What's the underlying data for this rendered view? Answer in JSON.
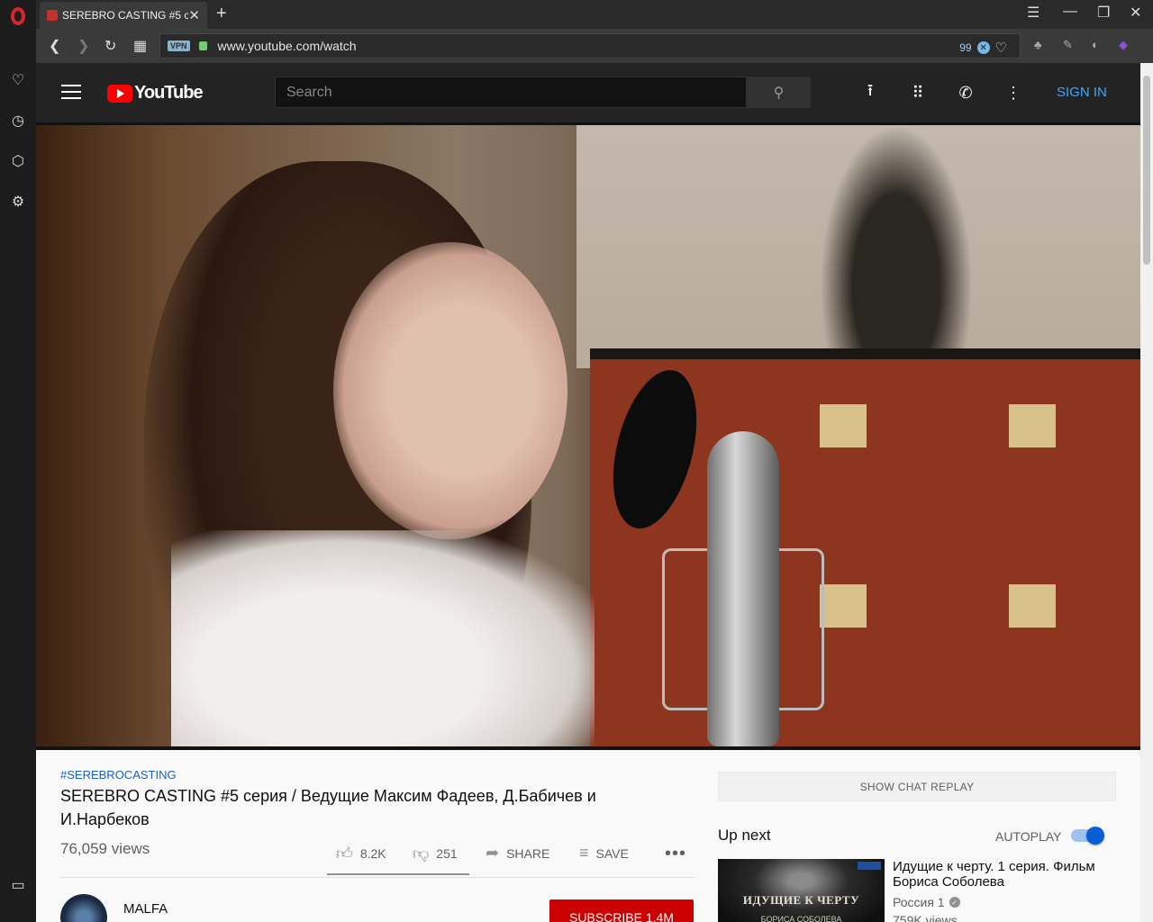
{
  "browser": {
    "tab_title": "SEREBRO CASTING #5 c",
    "url": "www.youtube.com/watch",
    "vpn_label": "VPN",
    "ad_block_count": "99",
    "new_tab_symbol": "+"
  },
  "youtube": {
    "logo_text": "YouTube",
    "search_placeholder": "Search",
    "sign_in": "SIGN IN"
  },
  "video": {
    "hashtag": "#SEREBROCASTING",
    "title": "SEREBRO CASTING #5 серия / Ведущие Максим Фадеев, Д.Бабичев и И.Нарбеков",
    "views": "76,059 views",
    "likes": "8.2K",
    "dislikes": "251",
    "share_label": "SHARE",
    "save_label": "SAVE",
    "channel_name": "MALFA",
    "subscribe_label": "SUBSCRIBE 1.4M"
  },
  "sidebar": {
    "show_chat_replay": "SHOW CHAT REPLAY",
    "up_next": "Up next",
    "autoplay": "AUTOPLAY",
    "autoplay_on": true,
    "recommended": [
      {
        "thumb_text": "ИДУЩИЕ К ЧЕРТУ",
        "thumb_subtext": "БОРИСА СОБОЛЕВА",
        "title": "Идущие к черту. 1 серия. Фильм Бориса Соболева",
        "channel": "Россия 1",
        "views": "759K views"
      }
    ]
  },
  "colors": {
    "accent_blue": "#3ea6ff",
    "subscribe_red": "#cc0000",
    "youtube_red": "#ff0000",
    "opera_red": "#d6262f"
  }
}
